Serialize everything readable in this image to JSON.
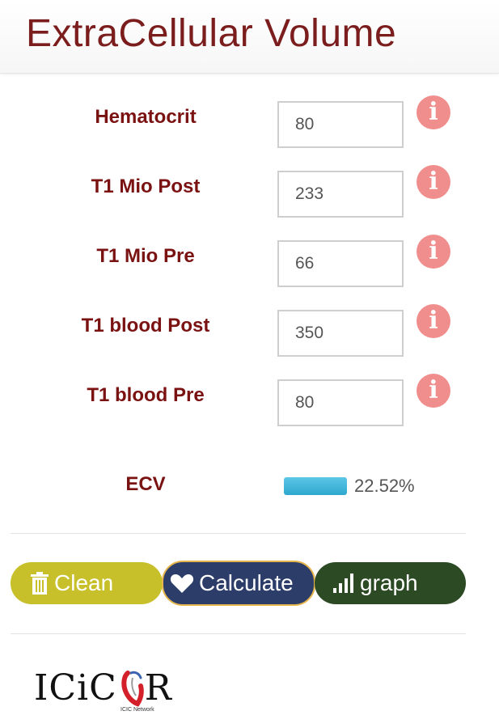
{
  "header": {
    "title": "ExtraCellular Volume"
  },
  "fields": [
    {
      "label": "Hematocrit",
      "value": "80"
    },
    {
      "label": "T1 Mio Post",
      "value": "233"
    },
    {
      "label": "T1 Mio Pre",
      "value": "66"
    },
    {
      "label": "T1 blood Post",
      "value": "350"
    },
    {
      "label": "T1 blood Pre",
      "value": "80"
    }
  ],
  "info_icon": {
    "glyph": "i",
    "color": "#f08e8e"
  },
  "ecv": {
    "label": "ECV",
    "value_text": "22.52%",
    "bar_fill_fraction": 1.0
  },
  "buttons": {
    "clean": {
      "label": "Clean",
      "icon": "trash-icon",
      "color": "#c8c02a"
    },
    "calculate": {
      "label": "Calculate",
      "icon": "heart-icon",
      "color": "#2c3d6a"
    },
    "graph": {
      "label": "graph",
      "icon": "bar-chart-icon",
      "color": "#2c4a24"
    }
  },
  "logo": {
    "text_left": "ICiC",
    "text_right": "R",
    "subtext": "ICIC Network"
  },
  "colors": {
    "label": "#7b1212",
    "title": "#7b1d1d",
    "progress": "#2ea8cf"
  }
}
